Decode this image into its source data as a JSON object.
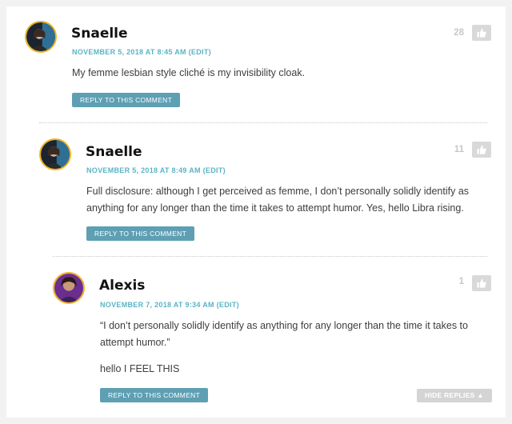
{
  "comments": [
    {
      "author": "Snaelle",
      "date": "November 5, 2018 at 8:45 am",
      "edit_label": "(Edit)",
      "paragraphs": [
        "My femme lesbian style cliché is my invisibility cloak."
      ],
      "likes": "28",
      "reply_label": "Reply to this comment",
      "like_icon": "thumbs-up-icon"
    },
    {
      "author": "Snaelle",
      "date": "November 5, 2018 at 8:49 am",
      "edit_label": "(Edit)",
      "paragraphs": [
        "Full disclosure: although I get perceived as femme, I don’t personally solidly identify as anything for any longer than the time it takes to attempt humor. Yes, hello Libra rising."
      ],
      "likes": "11",
      "reply_label": "Reply to this comment",
      "like_icon": "thumbs-up-icon"
    },
    {
      "author": "Alexis",
      "date": "November 7, 2018 at 9:34 am",
      "edit_label": "(Edit)",
      "paragraphs": [
        "“I don’t personally solidly identify as anything for any longer than the time it takes to attempt humor.”",
        "hello I FEEL THIS"
      ],
      "likes": "1",
      "reply_label": "Reply to this comment",
      "like_icon": "thumbs-up-icon"
    }
  ],
  "hide_replies_label": "Hide Replies ▲",
  "colors": {
    "accent": "#5ab4c5",
    "button": "#5e9fb3",
    "avatar_border": "#f0b323",
    "like_bg": "#d9d9d9"
  }
}
